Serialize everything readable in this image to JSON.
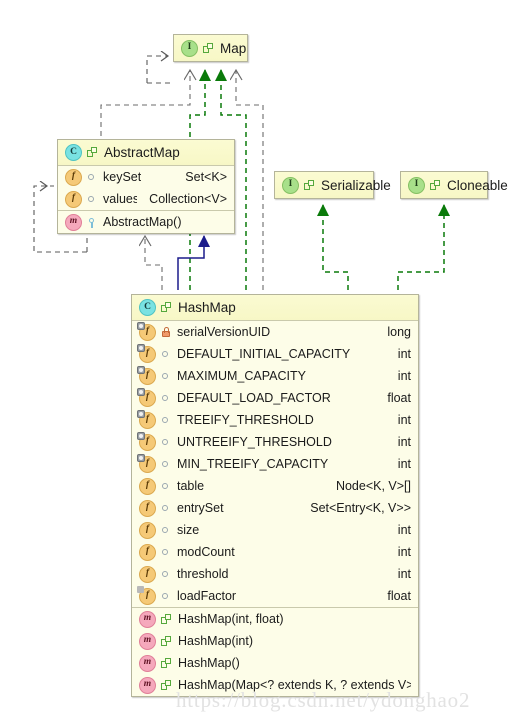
{
  "diagram": {
    "kind": "uml-class-diagram",
    "watermark": "https://blog.csdn.net/ydonghao2",
    "colors": {
      "box_fill": "#fdfde4",
      "title_fill": "#f8f8c8",
      "box_border": "#b4b49a",
      "realize_arrow": "#0a7a0a",
      "dependency_arrow": "#5a5a5a",
      "extends_arrow": "#1c1c8c",
      "class_icon": "#79e2e2",
      "interface_icon": "#a8e08a",
      "field_icon": "#f5c977",
      "method_icon": "#f5a8bc",
      "private_lock": "#f09a6a"
    }
  },
  "classes": {
    "map": {
      "name": "Map",
      "stereotype": "interface",
      "icon": "interface-icon",
      "letter": "I"
    },
    "serializable": {
      "name": "Serializable",
      "stereotype": "interface",
      "icon": "interface-icon",
      "letter": "I"
    },
    "cloneable": {
      "name": "Cloneable",
      "stereotype": "interface",
      "icon": "interface-icon",
      "letter": "I"
    },
    "abstractmap": {
      "name": "AbstractMap",
      "stereotype": "class",
      "icon": "class-icon",
      "letter": "C",
      "fields": [
        {
          "name": "keySet",
          "type": "Set<K>",
          "visibility": "public",
          "static": false
        },
        {
          "name": "values",
          "type": "Collection<V>",
          "visibility": "public",
          "static": false
        }
      ],
      "methods": [
        {
          "name": "AbstractMap()",
          "type": "",
          "visibility": "protected",
          "static": false
        }
      ]
    },
    "hashmap": {
      "name": "HashMap",
      "stereotype": "class",
      "icon": "class-icon",
      "letter": "C",
      "fields": [
        {
          "name": "serialVersionUID",
          "type": "long",
          "visibility": "private",
          "static": true
        },
        {
          "name": "DEFAULT_INITIAL_CAPACITY",
          "type": "int",
          "visibility": "public",
          "static": true
        },
        {
          "name": "MAXIMUM_CAPACITY",
          "type": "int",
          "visibility": "public",
          "static": true
        },
        {
          "name": "DEFAULT_LOAD_FACTOR",
          "type": "float",
          "visibility": "public",
          "static": true
        },
        {
          "name": "TREEIFY_THRESHOLD",
          "type": "int",
          "visibility": "public",
          "static": true
        },
        {
          "name": "UNTREEIFY_THRESHOLD",
          "type": "int",
          "visibility": "public",
          "static": true
        },
        {
          "name": "MIN_TREEIFY_CAPACITY",
          "type": "int",
          "visibility": "public",
          "static": true
        },
        {
          "name": "table",
          "type": "Node<K, V>[]",
          "visibility": "public",
          "static": false
        },
        {
          "name": "entrySet",
          "type": "Set<Entry<K, V>>",
          "visibility": "public",
          "static": false
        },
        {
          "name": "size",
          "type": "int",
          "visibility": "public",
          "static": false
        },
        {
          "name": "modCount",
          "type": "int",
          "visibility": "public",
          "static": false
        },
        {
          "name": "threshold",
          "type": "int",
          "visibility": "public",
          "static": false
        },
        {
          "name": "loadFactor",
          "type": "float",
          "visibility": "public",
          "static": false,
          "final": true
        }
      ],
      "methods": [
        {
          "name": "HashMap(int, float)",
          "type": "",
          "visibility": "public",
          "static": false
        },
        {
          "name": "HashMap(int)",
          "type": "",
          "visibility": "public",
          "static": false
        },
        {
          "name": "HashMap()",
          "type": "",
          "visibility": "public",
          "static": false
        },
        {
          "name": "HashMap(Map<? extends K, ? extends V>)",
          "type": "",
          "visibility": "public",
          "static": false
        }
      ]
    }
  },
  "relations": [
    {
      "from": "map",
      "to": "map",
      "type": "dependency",
      "style": "dashed",
      "color": "#5a5a5a"
    },
    {
      "from": "abstractmap",
      "to": "map",
      "type": "dependency",
      "style": "dashed",
      "color": "#5a5a5a"
    },
    {
      "from": "abstractmap",
      "to": "map",
      "type": "realization",
      "style": "dashed",
      "color": "#0a7a0a"
    },
    {
      "from": "hashmap",
      "to": "map",
      "type": "realization",
      "style": "dashed",
      "color": "#0a7a0a"
    },
    {
      "from": "hashmap",
      "to": "map",
      "type": "dependency",
      "style": "dashed",
      "color": "#5a5a5a"
    },
    {
      "from": "abstractmap",
      "to": "abstractmap",
      "type": "dependency",
      "style": "dashed",
      "color": "#5a5a5a"
    },
    {
      "from": "hashmap",
      "to": "abstractmap",
      "type": "generalization",
      "style": "solid",
      "color": "#1c1c8c"
    },
    {
      "from": "hashmap",
      "to": "abstractmap",
      "type": "dependency",
      "style": "dashed",
      "color": "#5a5a5a"
    },
    {
      "from": "hashmap",
      "to": "serializable",
      "type": "realization",
      "style": "dashed",
      "color": "#0a7a0a"
    },
    {
      "from": "hashmap",
      "to": "cloneable",
      "type": "realization",
      "style": "dashed",
      "color": "#0a7a0a"
    }
  ]
}
